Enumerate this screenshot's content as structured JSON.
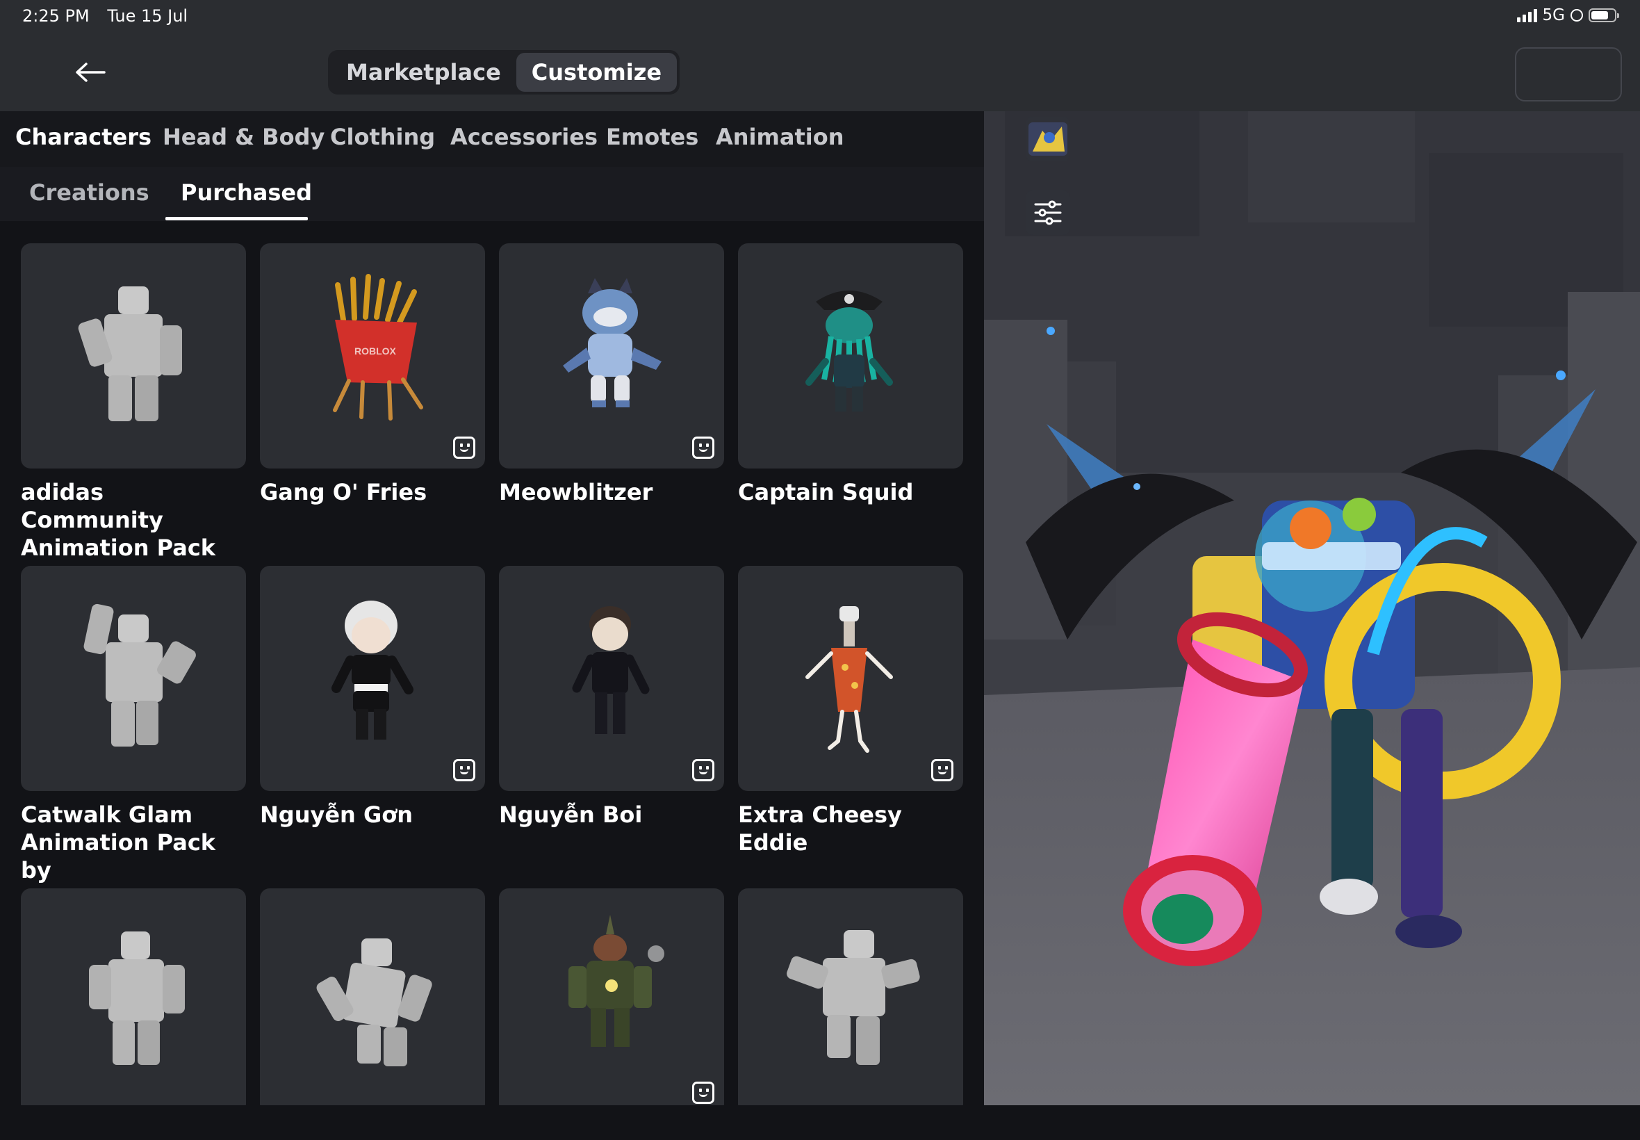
{
  "status_bar": {
    "time": "2:25 PM",
    "date": "Tue 15 Jul",
    "network": "5G"
  },
  "nav": {
    "back_icon": "arrow-left-icon",
    "segments": [
      {
        "label": "Marketplace",
        "active": false
      },
      {
        "label": "Customize",
        "active": true
      }
    ]
  },
  "category_tabs": [
    {
      "label": "Characters",
      "active": true
    },
    {
      "label": "Head & Body",
      "active": false
    },
    {
      "label": "Clothing",
      "active": false
    },
    {
      "label": "Accessories",
      "active": false
    },
    {
      "label": "Emotes",
      "active": false
    },
    {
      "label": "Animation",
      "active": false
    }
  ],
  "sub_tabs": [
    {
      "label": "Creations",
      "active": false
    },
    {
      "label": "Purchased",
      "active": true
    }
  ],
  "items": [
    {
      "name": "adidas Community Animation Pack",
      "badge": false
    },
    {
      "name": "Gang O' Fries",
      "badge": true
    },
    {
      "name": "Meowblitzer",
      "badge": true
    },
    {
      "name": "Captain Squid",
      "badge": false
    },
    {
      "name": "Catwalk Glam Animation Pack by",
      "badge": false
    },
    {
      "name": "Nguyễn Gơn",
      "badge": true
    },
    {
      "name": "Nguyễn Boi",
      "badge": true
    },
    {
      "name": "Extra Cheesy Eddie",
      "badge": true
    },
    {
      "name": "",
      "badge": false
    },
    {
      "name": "",
      "badge": false
    },
    {
      "name": "",
      "badge": true
    },
    {
      "name": "",
      "badge": false
    }
  ],
  "viewport": {
    "thumbnail_icon": "avatar-thumbnail-icon",
    "settings_icon": "sliders-icon"
  },
  "colors": {
    "panel_bg": "#121317",
    "card_bg": "#2c2e33",
    "active_segment": "#3b3d44"
  }
}
